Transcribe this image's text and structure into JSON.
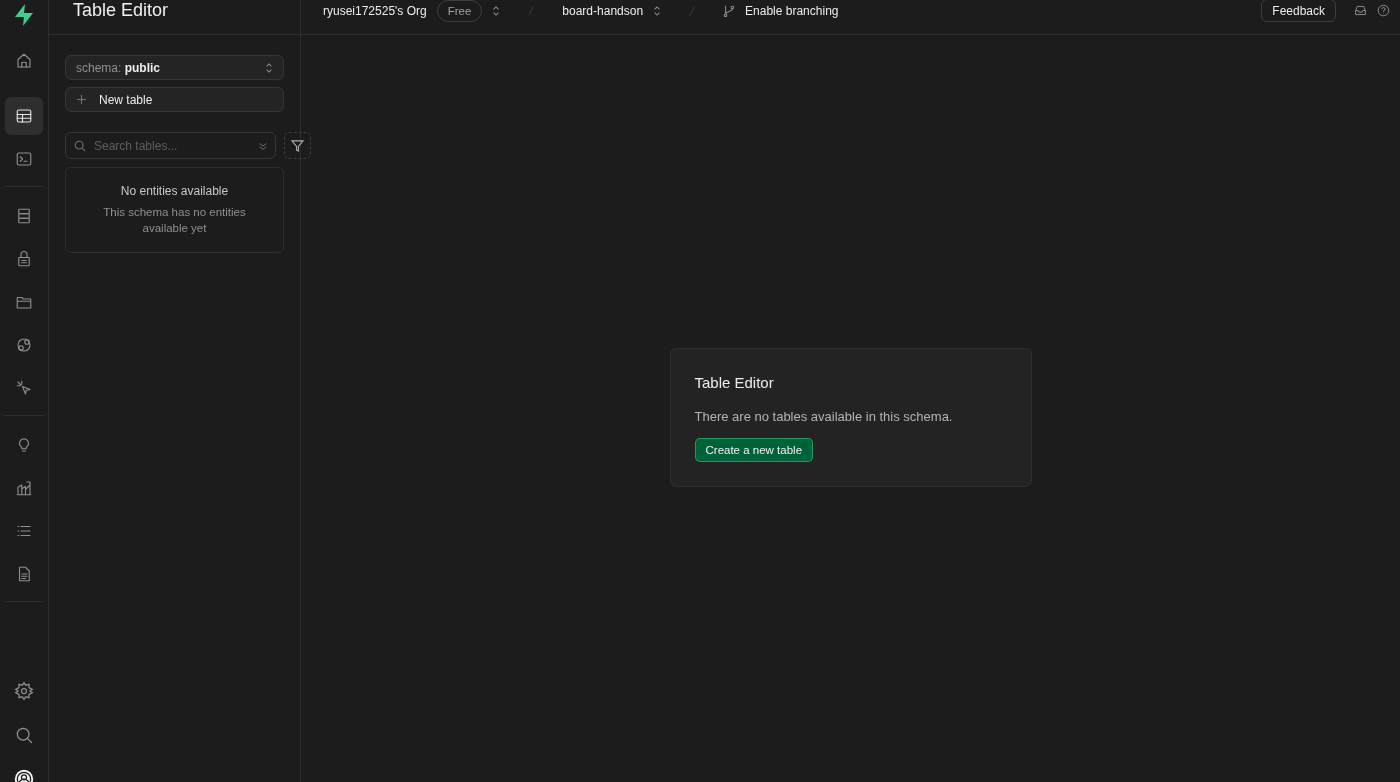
{
  "rail": {
    "groups": [
      {
        "items": [
          {
            "kind": "home",
            "selected": false
          },
          {
            "kind": "table",
            "selected": true
          },
          {
            "kind": "terminal",
            "selected": false
          }
        ]
      },
      {
        "items": [
          {
            "kind": "database",
            "selected": false
          },
          {
            "kind": "lock",
            "selected": false
          },
          {
            "kind": "folder",
            "selected": false
          },
          {
            "kind": "circles",
            "selected": false
          },
          {
            "kind": "cursor",
            "selected": false
          }
        ]
      },
      {
        "items": [
          {
            "kind": "bulb",
            "selected": false
          },
          {
            "kind": "chart",
            "selected": false
          },
          {
            "kind": "list",
            "selected": false
          },
          {
            "kind": "document",
            "selected": false
          }
        ]
      }
    ],
    "bottom": [
      {
        "kind": "settings",
        "selected": false
      },
      {
        "kind": "search",
        "selected": false
      },
      {
        "kind": "avatar",
        "selected": false
      }
    ]
  },
  "sidebar": {
    "title": "Table Editor",
    "schema": {
      "label": "schema:",
      "value": "public"
    },
    "new_table": "New table",
    "search": {
      "placeholder": "Search tables..."
    },
    "empty": {
      "title": "No entities available",
      "text": "This schema has no entities available yet"
    }
  },
  "topbar": {
    "org": "ryusei172525's Org",
    "plan": "Free",
    "project": "board-handson",
    "branching": "Enable branching",
    "feedback": "Feedback"
  },
  "card": {
    "title": "Table Editor",
    "text": "There are no tables available in this schema.",
    "button": "Create a new table"
  }
}
